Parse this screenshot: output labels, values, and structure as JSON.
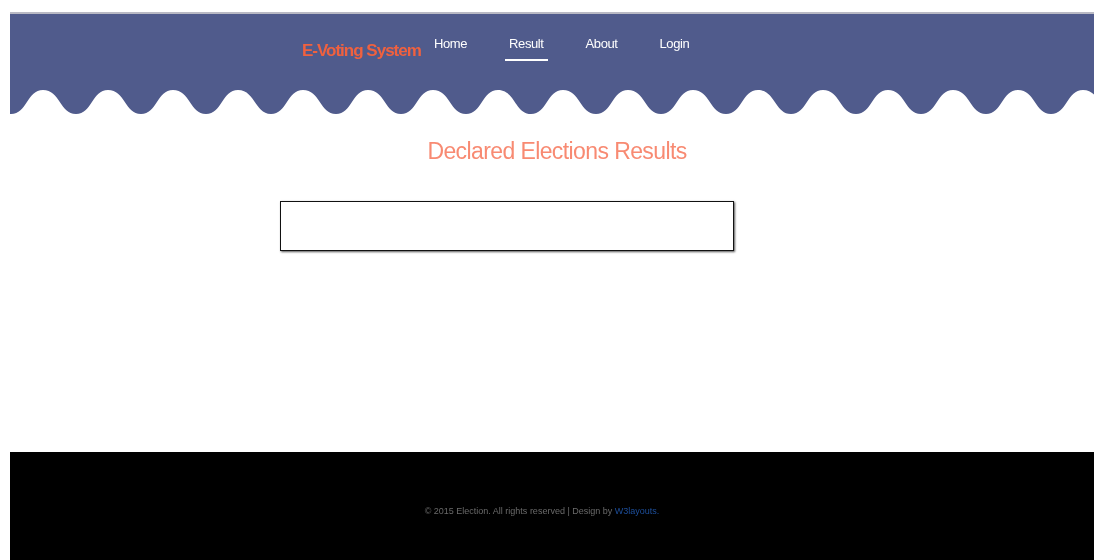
{
  "header": {
    "brand": "E-Voting System",
    "nav": [
      {
        "label": "Home",
        "selected": false
      },
      {
        "label": "Result",
        "selected": true
      },
      {
        "label": "About",
        "selected": false
      },
      {
        "label": "Login",
        "selected": false
      }
    ]
  },
  "main": {
    "title": "Declared Elections Results"
  },
  "footer": {
    "text": "© 2015 Election. All rights reserved | Design by",
    "link": "W3layouts."
  }
}
